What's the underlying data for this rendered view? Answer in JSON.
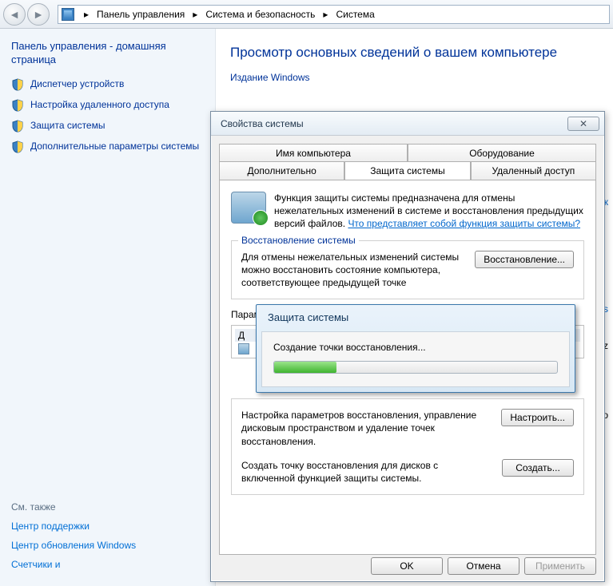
{
  "breadcrumb": {
    "root": "Панель управления",
    "level2": "Система и безопасность",
    "level3": "Система"
  },
  "sidebar": {
    "heading": "Панель управления - домашняя страница",
    "items": [
      {
        "label": "Диспетчер устройств"
      },
      {
        "label": "Настройка удаленного доступа"
      },
      {
        "label": "Защита системы"
      },
      {
        "label": "Дополнительные параметры системы"
      }
    ],
    "see_also_label": "См. также",
    "see_also": [
      {
        "label": "Центр поддержки"
      },
      {
        "label": "Центр обновления Windows"
      },
      {
        "label": "Счетчики и"
      }
    ]
  },
  "content": {
    "title": "Просмотр основных сведений о вашем компьютере",
    "section": "Издание Windows",
    "rt1": "уск",
    "rt2": "s",
    "rt3": "GHz",
    "rt4": "ого"
  },
  "dialog": {
    "title": "Свойства системы",
    "tabs_row1": [
      "Имя компьютера",
      "Оборудование"
    ],
    "tabs_row2": [
      "Дополнительно",
      "Защита системы",
      "Удаленный доступ"
    ],
    "intro_text": "Функция защиты системы предназначена для отмены нежелательных изменений в системе и восстановления предыдущих версий файлов. ",
    "intro_link": "Что представляет собой функция защиты системы?",
    "group1": {
      "title": "Восстановление системы",
      "text": "Для отмены нежелательных изменений системы можно восстановить состояние компьютера, соответствующее предыдущей точке",
      "button": "Восстановление..."
    },
    "params_label": "Парам",
    "cellD": "Д",
    "group2": {
      "row1_text": "Настройка параметров восстановления, управление дисковым пространством и удаление точек восстановления.",
      "row1_btn": "Настроить...",
      "row2_text": "Создать точку восстановления для дисков с включенной функцией защиты системы.",
      "row2_btn": "Создать..."
    },
    "buttons": {
      "ok": "OK",
      "cancel": "Отмена",
      "apply": "Применить"
    }
  },
  "progress": {
    "title": "Защита системы",
    "status": "Создание точки восстановления..."
  }
}
